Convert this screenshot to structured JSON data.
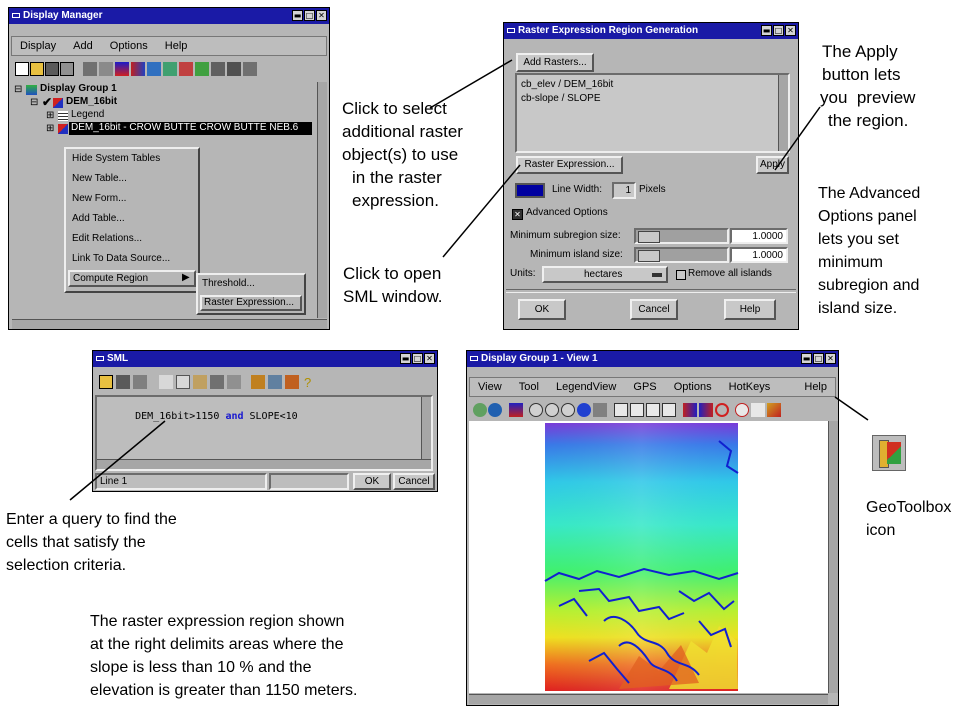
{
  "display_manager": {
    "title": "Display Manager",
    "menus": [
      "Display",
      "Add",
      "Options",
      "Help"
    ],
    "tree": {
      "group": "Display Group 1",
      "layer": "DEM_16bit",
      "legend": "Legend",
      "object": "DEM_16bit - CROW BUTTE CROW BUTTE NEB.6"
    },
    "context_menu": [
      "Hide System Tables",
      "New Table...",
      "New Form...",
      "Add Table...",
      "Edit Relations...",
      "Link To Data Source...",
      "Compute Region"
    ],
    "submenu": [
      "Threshold...",
      "Raster Expression..."
    ]
  },
  "raster_dialog": {
    "title": "Raster Expression Region Generation",
    "add_rasters": "Add Rasters...",
    "rasters": [
      "cb_elev / DEM_16bit",
      "cb-slope / SLOPE"
    ],
    "raster_expression": "Raster Expression...",
    "apply": "Apply",
    "line_width_label": "Line Width:",
    "line_width_value": "1",
    "pixels": "Pixels",
    "advanced_options": "Advanced Options",
    "min_subregion_label": "Minimum subregion size:",
    "min_subregion_value": "1.0000",
    "min_island_label": "Minimum island size:",
    "min_island_value": "1.0000",
    "units_label": "Units:",
    "units_value": "hectares",
    "remove_islands": "Remove all islands",
    "ok": "OK",
    "cancel": "Cancel",
    "help": "Help",
    "line_color": "#0000a0"
  },
  "sml": {
    "title": "SML",
    "expr_a": "DEM_16bit>1150 ",
    "expr_and": "and",
    "expr_b": " SLOPE<10",
    "status": "Line 1",
    "ok": "OK",
    "cancel": "Cancel"
  },
  "view": {
    "title": "Display Group 1 - View 1",
    "menus": [
      "View",
      "Tool",
      "LegendView",
      "GPS",
      "Options",
      "HotKeys"
    ],
    "help": "Help"
  },
  "annotations": {
    "select_rasters": [
      "Click to select",
      "additional raster",
      "object(s) to use",
      "in the raster",
      "expression."
    ],
    "open_sml": [
      "Click to open",
      "SML window."
    ],
    "apply": [
      "The Apply",
      "button lets",
      "you  preview",
      "the region."
    ],
    "advanced": [
      "The Advanced",
      "Options panel",
      "lets you set",
      "minimum",
      "subregion and",
      "island size."
    ],
    "query": [
      "Enter a query to find the",
      "cells that satisfy the",
      "selection criteria."
    ],
    "summary": [
      "The raster expression region shown",
      "at the right delimits areas where the",
      "slope is less than 10 % and the",
      "elevation is greater than 1150 meters."
    ],
    "geotoolbox": [
      "GeoToolbox",
      "icon"
    ]
  }
}
